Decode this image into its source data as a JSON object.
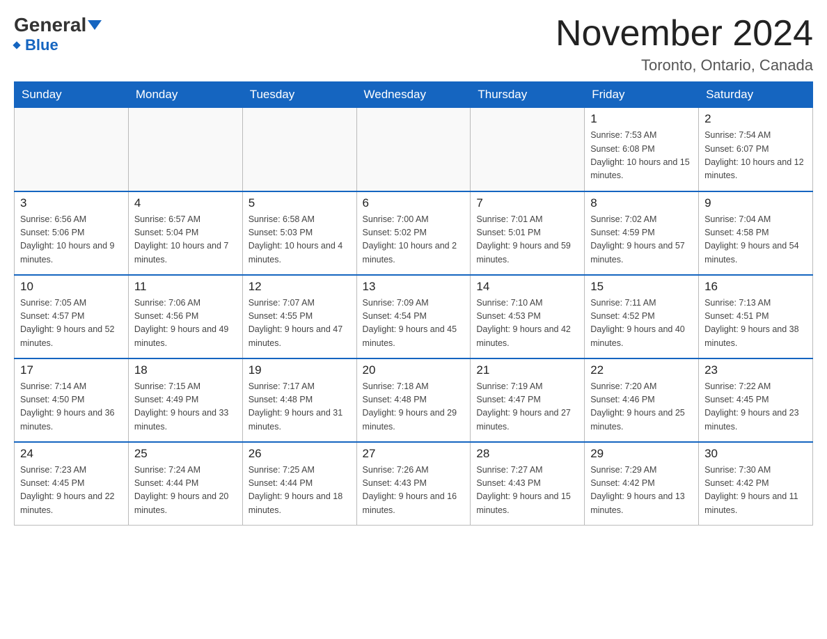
{
  "header": {
    "logo_general": "General",
    "logo_blue": "Blue",
    "month_title": "November 2024",
    "location": "Toronto, Ontario, Canada"
  },
  "weekdays": [
    "Sunday",
    "Monday",
    "Tuesday",
    "Wednesday",
    "Thursday",
    "Friday",
    "Saturday"
  ],
  "weeks": [
    [
      {
        "day": "",
        "sunrise": "",
        "sunset": "",
        "daylight": ""
      },
      {
        "day": "",
        "sunrise": "",
        "sunset": "",
        "daylight": ""
      },
      {
        "day": "",
        "sunrise": "",
        "sunset": "",
        "daylight": ""
      },
      {
        "day": "",
        "sunrise": "",
        "sunset": "",
        "daylight": ""
      },
      {
        "day": "",
        "sunrise": "",
        "sunset": "",
        "daylight": ""
      },
      {
        "day": "1",
        "sunrise": "Sunrise: 7:53 AM",
        "sunset": "Sunset: 6:08 PM",
        "daylight": "Daylight: 10 hours and 15 minutes."
      },
      {
        "day": "2",
        "sunrise": "Sunrise: 7:54 AM",
        "sunset": "Sunset: 6:07 PM",
        "daylight": "Daylight: 10 hours and 12 minutes."
      }
    ],
    [
      {
        "day": "3",
        "sunrise": "Sunrise: 6:56 AM",
        "sunset": "Sunset: 5:06 PM",
        "daylight": "Daylight: 10 hours and 9 minutes."
      },
      {
        "day": "4",
        "sunrise": "Sunrise: 6:57 AM",
        "sunset": "Sunset: 5:04 PM",
        "daylight": "Daylight: 10 hours and 7 minutes."
      },
      {
        "day": "5",
        "sunrise": "Sunrise: 6:58 AM",
        "sunset": "Sunset: 5:03 PM",
        "daylight": "Daylight: 10 hours and 4 minutes."
      },
      {
        "day": "6",
        "sunrise": "Sunrise: 7:00 AM",
        "sunset": "Sunset: 5:02 PM",
        "daylight": "Daylight: 10 hours and 2 minutes."
      },
      {
        "day": "7",
        "sunrise": "Sunrise: 7:01 AM",
        "sunset": "Sunset: 5:01 PM",
        "daylight": "Daylight: 9 hours and 59 minutes."
      },
      {
        "day": "8",
        "sunrise": "Sunrise: 7:02 AM",
        "sunset": "Sunset: 4:59 PM",
        "daylight": "Daylight: 9 hours and 57 minutes."
      },
      {
        "day": "9",
        "sunrise": "Sunrise: 7:04 AM",
        "sunset": "Sunset: 4:58 PM",
        "daylight": "Daylight: 9 hours and 54 minutes."
      }
    ],
    [
      {
        "day": "10",
        "sunrise": "Sunrise: 7:05 AM",
        "sunset": "Sunset: 4:57 PM",
        "daylight": "Daylight: 9 hours and 52 minutes."
      },
      {
        "day": "11",
        "sunrise": "Sunrise: 7:06 AM",
        "sunset": "Sunset: 4:56 PM",
        "daylight": "Daylight: 9 hours and 49 minutes."
      },
      {
        "day": "12",
        "sunrise": "Sunrise: 7:07 AM",
        "sunset": "Sunset: 4:55 PM",
        "daylight": "Daylight: 9 hours and 47 minutes."
      },
      {
        "day": "13",
        "sunrise": "Sunrise: 7:09 AM",
        "sunset": "Sunset: 4:54 PM",
        "daylight": "Daylight: 9 hours and 45 minutes."
      },
      {
        "day": "14",
        "sunrise": "Sunrise: 7:10 AM",
        "sunset": "Sunset: 4:53 PM",
        "daylight": "Daylight: 9 hours and 42 minutes."
      },
      {
        "day": "15",
        "sunrise": "Sunrise: 7:11 AM",
        "sunset": "Sunset: 4:52 PM",
        "daylight": "Daylight: 9 hours and 40 minutes."
      },
      {
        "day": "16",
        "sunrise": "Sunrise: 7:13 AM",
        "sunset": "Sunset: 4:51 PM",
        "daylight": "Daylight: 9 hours and 38 minutes."
      }
    ],
    [
      {
        "day": "17",
        "sunrise": "Sunrise: 7:14 AM",
        "sunset": "Sunset: 4:50 PM",
        "daylight": "Daylight: 9 hours and 36 minutes."
      },
      {
        "day": "18",
        "sunrise": "Sunrise: 7:15 AM",
        "sunset": "Sunset: 4:49 PM",
        "daylight": "Daylight: 9 hours and 33 minutes."
      },
      {
        "day": "19",
        "sunrise": "Sunrise: 7:17 AM",
        "sunset": "Sunset: 4:48 PM",
        "daylight": "Daylight: 9 hours and 31 minutes."
      },
      {
        "day": "20",
        "sunrise": "Sunrise: 7:18 AM",
        "sunset": "Sunset: 4:48 PM",
        "daylight": "Daylight: 9 hours and 29 minutes."
      },
      {
        "day": "21",
        "sunrise": "Sunrise: 7:19 AM",
        "sunset": "Sunset: 4:47 PM",
        "daylight": "Daylight: 9 hours and 27 minutes."
      },
      {
        "day": "22",
        "sunrise": "Sunrise: 7:20 AM",
        "sunset": "Sunset: 4:46 PM",
        "daylight": "Daylight: 9 hours and 25 minutes."
      },
      {
        "day": "23",
        "sunrise": "Sunrise: 7:22 AM",
        "sunset": "Sunset: 4:45 PM",
        "daylight": "Daylight: 9 hours and 23 minutes."
      }
    ],
    [
      {
        "day": "24",
        "sunrise": "Sunrise: 7:23 AM",
        "sunset": "Sunset: 4:45 PM",
        "daylight": "Daylight: 9 hours and 22 minutes."
      },
      {
        "day": "25",
        "sunrise": "Sunrise: 7:24 AM",
        "sunset": "Sunset: 4:44 PM",
        "daylight": "Daylight: 9 hours and 20 minutes."
      },
      {
        "day": "26",
        "sunrise": "Sunrise: 7:25 AM",
        "sunset": "Sunset: 4:44 PM",
        "daylight": "Daylight: 9 hours and 18 minutes."
      },
      {
        "day": "27",
        "sunrise": "Sunrise: 7:26 AM",
        "sunset": "Sunset: 4:43 PM",
        "daylight": "Daylight: 9 hours and 16 minutes."
      },
      {
        "day": "28",
        "sunrise": "Sunrise: 7:27 AM",
        "sunset": "Sunset: 4:43 PM",
        "daylight": "Daylight: 9 hours and 15 minutes."
      },
      {
        "day": "29",
        "sunrise": "Sunrise: 7:29 AM",
        "sunset": "Sunset: 4:42 PM",
        "daylight": "Daylight: 9 hours and 13 minutes."
      },
      {
        "day": "30",
        "sunrise": "Sunrise: 7:30 AM",
        "sunset": "Sunset: 4:42 PM",
        "daylight": "Daylight: 9 hours and 11 minutes."
      }
    ]
  ]
}
